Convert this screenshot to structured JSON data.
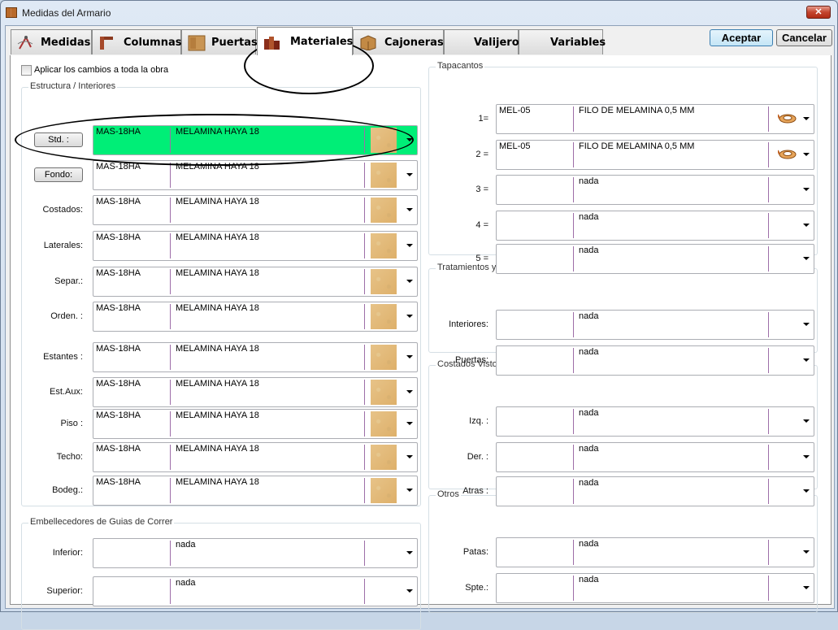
{
  "window": {
    "title": "Medidas del Armario",
    "close_label": "✕"
  },
  "tabs": [
    {
      "label": "Medidas",
      "icon": "compass-icon"
    },
    {
      "label": "Columnas",
      "icon": "column-icon"
    },
    {
      "label": "Puertas",
      "icon": "door-icon"
    },
    {
      "label": "Materiales",
      "icon": "boards-icon",
      "active": true
    },
    {
      "label": "Cajoneras",
      "icon": "drawer-icon"
    },
    {
      "label": "Valijero"
    },
    {
      "label": "Variables"
    }
  ],
  "buttons": {
    "accept": "Aceptar",
    "cancel": "Cancelar"
  },
  "apply_all": {
    "label": "Aplicar los cambios a toda la obra",
    "checked": false
  },
  "estructura": {
    "title": "Estructura / Interiores",
    "rows": [
      {
        "label": "Std. :",
        "button": true,
        "code": "MAS-18HA",
        "desc": "MELAMINA HAYA 18",
        "selected": true
      },
      {
        "label": "Fondo:",
        "button": true,
        "code": "MAS-18HA",
        "desc": "MELAMINA HAYA 18"
      },
      {
        "label": "Costados:",
        "code": "MAS-18HA",
        "desc": "MELAMINA HAYA 18"
      },
      {
        "label": "Laterales:",
        "code": "MAS-18HA",
        "desc": "MELAMINA HAYA 18"
      },
      {
        "label": "Separ.:",
        "code": "MAS-18HA",
        "desc": "MELAMINA HAYA 18"
      },
      {
        "label": "Orden. :",
        "code": "MAS-18HA",
        "desc": "MELAMINA HAYA 18"
      },
      {
        "label": "Estantes :",
        "code": "MAS-18HA",
        "desc": "MELAMINA HAYA 18"
      },
      {
        "label": "Est.Aux:",
        "code": "MAS-18HA",
        "desc": "MELAMINA HAYA 18"
      },
      {
        "label": "Piso :",
        "code": "MAS-18HA",
        "desc": "MELAMINA HAYA 18"
      },
      {
        "label": "Techo:",
        "code": "MAS-18HA",
        "desc": "MELAMINA HAYA 18"
      },
      {
        "label": "Bodeg.:",
        "code": "MAS-18HA",
        "desc": "MELAMINA HAYA 18"
      }
    ]
  },
  "embellecedores": {
    "title": "Embellecedores de Guias de Correr",
    "rows": [
      {
        "label": "Inferior:",
        "code": "",
        "desc": "nada"
      },
      {
        "label": "Superior:",
        "code": "",
        "desc": "nada"
      }
    ]
  },
  "tapacantos": {
    "title": "Tapacantos",
    "rows": [
      {
        "label": "1=",
        "code": "MEL-05",
        "desc": "FILO DE MELAMINA 0,5 MM",
        "icon": "edge-roll-icon"
      },
      {
        "label": "2 =",
        "code": "MEL-05",
        "desc": "FILO DE MELAMINA 0,5 MM",
        "icon": "edge-roll-icon"
      },
      {
        "label": "3 =",
        "code": "",
        "desc": "nada"
      },
      {
        "label": "4 =",
        "code": "",
        "desc": "nada"
      },
      {
        "label": "5 =",
        "code": "",
        "desc": "nada"
      }
    ]
  },
  "tratamientos": {
    "title": "Tratamientos y Barnizados",
    "rows": [
      {
        "label": "Interiores:",
        "code": "",
        "desc": "nada"
      },
      {
        "label": "Puertas:",
        "code": "",
        "desc": "nada"
      }
    ]
  },
  "costados": {
    "title": "Costados Vistos",
    "rows": [
      {
        "label": "Izq. :",
        "code": "",
        "desc": "nada"
      },
      {
        "label": "Der. :",
        "code": "",
        "desc": "nada"
      },
      {
        "label": "Atras :",
        "code": "",
        "desc": "nada"
      }
    ]
  },
  "otros": {
    "title": "Otros",
    "rows": [
      {
        "label": "Patas:",
        "code": "",
        "desc": "nada"
      },
      {
        "label": "Spte.:",
        "code": "",
        "desc": "nada"
      }
    ]
  },
  "colors": {
    "selected_row": "#00ee77",
    "separator": "#9d6ea8",
    "wood": "#e2bb7a"
  }
}
